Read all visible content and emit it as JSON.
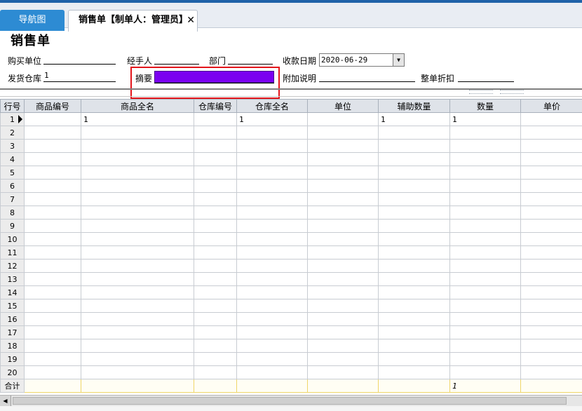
{
  "tabs": [
    {
      "label": "导航图"
    },
    {
      "label": "销售单【制单人：管理员】",
      "close_glyph": "✕"
    }
  ],
  "page_title": "销售单",
  "form": {
    "buyer_label": "购买单位",
    "buyer_value": "",
    "handler_label": "经手人",
    "handler_value": "",
    "dept_label": "部门",
    "dept_value": "",
    "date_label": "收款日期",
    "date_value": "2020-06-29",
    "warehouse_label": "发货仓库",
    "warehouse_value": "1",
    "summary_label": "摘要",
    "summary_value": "",
    "note_label": "附加说明",
    "note_value": "",
    "discount_label": "整单折扣",
    "discount_value": ""
  },
  "grid": {
    "columns": [
      "行号",
      "商品编号",
      "商品全名",
      "仓库编号",
      "仓库全名",
      "单位",
      "辅助数量",
      "数量",
      "单价"
    ],
    "rows": [
      [
        "1",
        "",
        "1",
        "",
        "1",
        "",
        "1",
        "1",
        ""
      ],
      [
        "2",
        "",
        "",
        "",
        "",
        "",
        "",
        "",
        ""
      ],
      [
        "3",
        "",
        "",
        "",
        "",
        "",
        "",
        "",
        ""
      ],
      [
        "4",
        "",
        "",
        "",
        "",
        "",
        "",
        "",
        ""
      ],
      [
        "5",
        "",
        "",
        "",
        "",
        "",
        "",
        "",
        ""
      ],
      [
        "6",
        "",
        "",
        "",
        "",
        "",
        "",
        "",
        ""
      ],
      [
        "7",
        "",
        "",
        "",
        "",
        "",
        "",
        "",
        ""
      ],
      [
        "8",
        "",
        "",
        "",
        "",
        "",
        "",
        "",
        ""
      ],
      [
        "9",
        "",
        "",
        "",
        "",
        "",
        "",
        "",
        ""
      ],
      [
        "10",
        "",
        "",
        "",
        "",
        "",
        "",
        "",
        ""
      ],
      [
        "11",
        "",
        "",
        "",
        "",
        "",
        "",
        "",
        ""
      ],
      [
        "12",
        "",
        "",
        "",
        "",
        "",
        "",
        "",
        ""
      ],
      [
        "13",
        "",
        "",
        "",
        "",
        "",
        "",
        "",
        ""
      ],
      [
        "14",
        "",
        "",
        "",
        "",
        "",
        "",
        "",
        ""
      ],
      [
        "15",
        "",
        "",
        "",
        "",
        "",
        "",
        "",
        ""
      ],
      [
        "16",
        "",
        "",
        "",
        "",
        "",
        "",
        "",
        ""
      ],
      [
        "17",
        "",
        "",
        "",
        "",
        "",
        "",
        "",
        ""
      ],
      [
        "18",
        "",
        "",
        "",
        "",
        "",
        "",
        "",
        ""
      ],
      [
        "19",
        "",
        "",
        "",
        "",
        "",
        "",
        "",
        ""
      ],
      [
        "20",
        "",
        "",
        "",
        "",
        "",
        "",
        "",
        ""
      ]
    ],
    "total_row": [
      "合计",
      "",
      "",
      "",
      "",
      "",
      "",
      "1",
      ""
    ]
  },
  "colors": {
    "nav_tab": "#2d8bd3",
    "summary_fill": "#7b00f0",
    "highlight_border": "#e3151b"
  }
}
